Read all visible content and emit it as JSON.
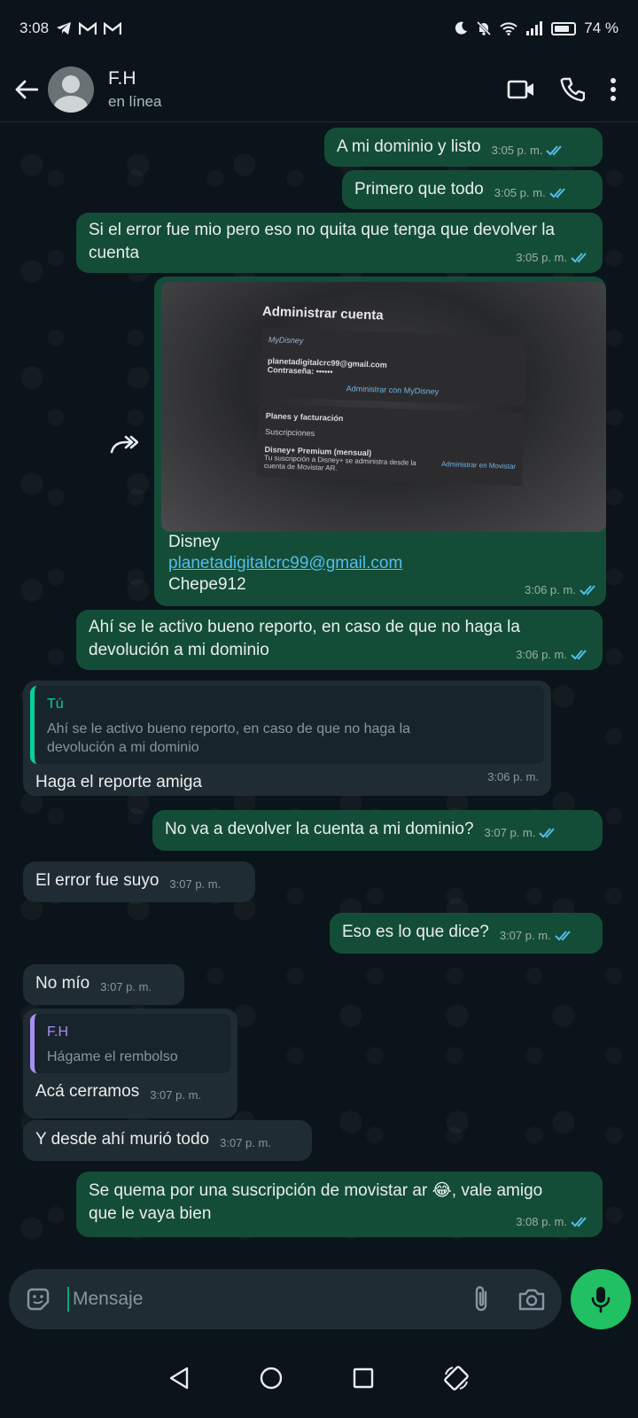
{
  "status_bar": {
    "time": "3:08",
    "battery": "74 %"
  },
  "header": {
    "name": "F.H",
    "status": "en línea"
  },
  "messages": {
    "m1": {
      "text": "A mi dominio y listo",
      "time": "3:05 p. m."
    },
    "m2": {
      "text": "Primero que todo",
      "time": "3:05 p. m."
    },
    "m3": {
      "line1": "Si el error fue mio pero eso no quita que tenga que devolver la",
      "line2": "cuenta",
      "time": "3:05 p. m."
    },
    "m4": {
      "caption1": "Disney",
      "caption2": "planetadigitalcrc99@gmail.com",
      "caption3": "Chepe912",
      "time": "3:06 p. m.",
      "image": {
        "title": "Administrar cuenta",
        "brand": "MyDisney",
        "email": "planetadigitalcrc99@gmail.com",
        "password": "Contraseña: ••••••",
        "link": "Administrar con MyDisney",
        "section": "Planes y facturación",
        "subs": "Suscripciones",
        "plan": "Disney+ Premium (mensual)",
        "plan_note": "Tu suscripción a Disney+ se administra desde la cuenta de Movistar AR.",
        "plan_link": "Administrar en Movistar"
      }
    },
    "m5": {
      "line1": "Ahí se le activo bueno reporto, en caso de que no haga la",
      "line2": "devolución a mi dominio",
      "time": "3:06 p. m."
    },
    "m6": {
      "quote_name": "Tú",
      "quote_line1": "Ahí se le activo bueno reporto, en caso de que no haga la",
      "quote_line2": "devolución a mi dominio",
      "text": "Haga el reporte amiga",
      "time": "3:06 p. m."
    },
    "m7": {
      "text": "No va a devolver la cuenta a mi dominio?",
      "time": "3:07 p. m."
    },
    "m8": {
      "text": "El error fue suyo",
      "time": "3:07 p. m."
    },
    "m9": {
      "text": "Eso es lo que dice?",
      "time": "3:07 p. m."
    },
    "m10": {
      "text": "No mío",
      "time": "3:07 p. m."
    },
    "m11": {
      "quote_name": "F.H",
      "quote_text": "Hágame el rembolso",
      "text": "Acá cerramos",
      "time": "3:07 p. m."
    },
    "m12": {
      "text": "Y desde ahí murió todo",
      "time": "3:07 p. m."
    },
    "m13": {
      "line1": "Se quema por una suscripción de movistar ar 😂, vale amigo",
      "line2": "que le vaya bien",
      "time": "3:08 p. m."
    }
  },
  "composer": {
    "placeholder": "Mensaje"
  },
  "colors": {
    "outgoing": "#144d37",
    "incoming": "#202c33",
    "accent": "#21c063",
    "read_ticks": "#53bdeb"
  }
}
